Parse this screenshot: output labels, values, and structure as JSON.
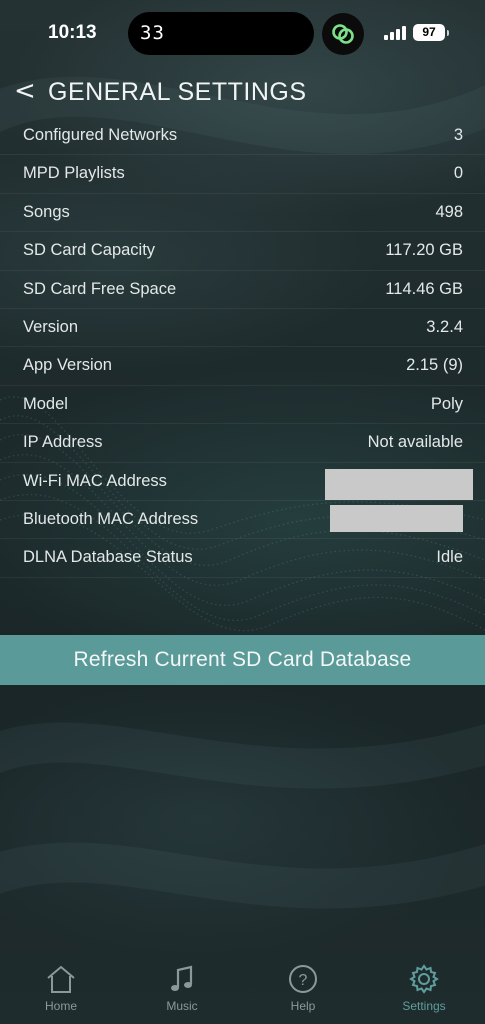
{
  "status_bar": {
    "time": "10:13",
    "island_text": "33",
    "battery": "97"
  },
  "header": {
    "back_label": "<",
    "title": "GENERAL SETTINGS"
  },
  "settings": [
    {
      "label": "Configured Networks",
      "value": "3"
    },
    {
      "label": "MPD Playlists",
      "value": "0"
    },
    {
      "label": "Songs",
      "value": "498"
    },
    {
      "label": "SD Card Capacity",
      "value": "117.20 GB"
    },
    {
      "label": "SD Card Free Space",
      "value": "114.46 GB"
    },
    {
      "label": "Version",
      "value": "3.2.4"
    },
    {
      "label": "App Version",
      "value": "2.15 (9)"
    },
    {
      "label": "Model",
      "value": "Poly"
    },
    {
      "label": "IP Address",
      "value": "Not available"
    },
    {
      "label": "Wi-Fi MAC Address",
      "value": null
    },
    {
      "label": "Bluetooth MAC Address",
      "value": null
    },
    {
      "label": "DLNA Database Status",
      "value": "Idle"
    }
  ],
  "refresh_button": {
    "label": "Refresh Current SD Card Database"
  },
  "tabs": [
    {
      "label": "Home",
      "icon": "home-icon"
    },
    {
      "label": "Music",
      "icon": "music-note-icon"
    },
    {
      "label": "Help",
      "icon": "help-icon"
    },
    {
      "label": "Settings",
      "icon": "gear-icon",
      "active": true
    }
  ],
  "colors": {
    "accent": "#5a9a98",
    "active_tab": "#5f9e9c",
    "inactive_tab": "#8a9a9c",
    "background": "#1b2628"
  }
}
